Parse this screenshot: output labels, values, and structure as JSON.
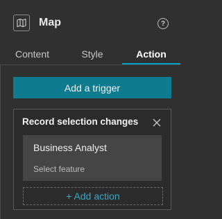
{
  "header": {
    "title": "Map",
    "help_glyph": "?",
    "icons": {
      "widget": "map-icon",
      "help": "help-icon"
    }
  },
  "tabs": [
    {
      "label": "Content",
      "active": false
    },
    {
      "label": "Style",
      "active": false
    },
    {
      "label": "Action",
      "active": true
    }
  ],
  "actions_panel": {
    "add_trigger_label": "Add a trigger",
    "trigger_card": {
      "title": "Record selection changes",
      "actions": [
        {
          "name": "Business Analyst",
          "detail": "Select feature"
        }
      ],
      "add_action_label": "+ Add action"
    }
  },
  "colors": {
    "background": "#303030",
    "accent": "#00a0c3",
    "button": "#0f7b8f",
    "link": "#36a8c8"
  }
}
